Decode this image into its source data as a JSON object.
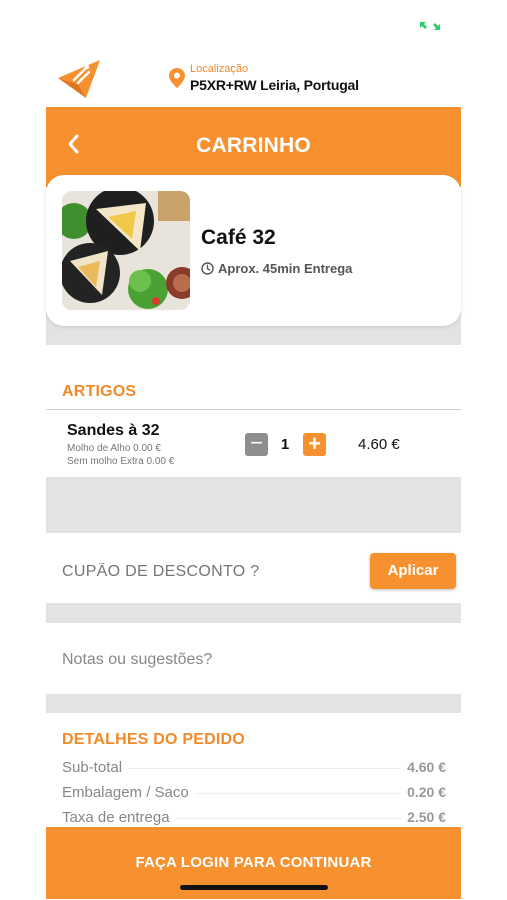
{
  "status_bar": {
    "indicator_icon": "arrows-expand-icon",
    "indicator_color": "#2ecc71"
  },
  "location": {
    "label": "Localização",
    "value": "P5XR+RW Leiria, Portugal"
  },
  "header": {
    "title": "CARRINHO"
  },
  "restaurant": {
    "name": "Café 32",
    "delivery_time": "Aprox. 45min Entrega"
  },
  "items_section": {
    "title": "ARTIGOS"
  },
  "items": [
    {
      "name": "Sandes à 32",
      "options": [
        "Molho de Alho 0.00 €",
        "Sem molho Extra 0.00 €"
      ],
      "quantity": "1",
      "minus_label": "−",
      "plus_label": "+",
      "price": "4.60 €"
    }
  ],
  "coupon": {
    "placeholder": "CUPÃO DE DESCONTO ?",
    "apply_label": "Aplicar"
  },
  "notes": {
    "placeholder": "Notas ou sugestões?"
  },
  "order_details": {
    "title": "DETALHES DO PEDIDO",
    "rows": [
      {
        "label": "Sub-total",
        "value": "4.60 €"
      },
      {
        "label": "Embalagem / Saco",
        "value": "0.20 €"
      },
      {
        "label": "Taxa de entrega",
        "value": "2.50 €"
      }
    ]
  },
  "footer": {
    "login_label": "FAÇA LOGIN PARA CONTINUAR"
  },
  "colors": {
    "accent": "#f7912f",
    "gray_band": "#e3e3e3"
  }
}
